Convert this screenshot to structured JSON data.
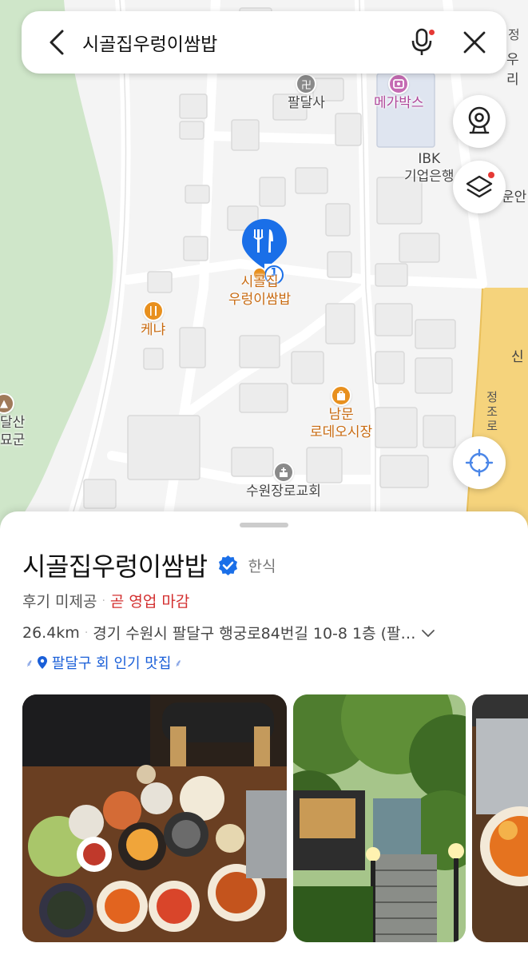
{
  "search": {
    "query": "시골집우렁이쌈밥"
  },
  "map": {
    "labels": {
      "paldalsa": "팔달사",
      "megabox": "메가박스",
      "ibk_line1": "IBK",
      "ibk_line2": "기업은행",
      "selected_line1": "시골집",
      "selected_line2": "우렁이쌈밥",
      "marker_badge": "1",
      "kenya": "케냐",
      "nammun_line1": "남문",
      "nammun_line2": "로데오시장",
      "church": "수원장로교회",
      "tomb_line1": "달산",
      "tomb_line2": "묘군",
      "road": "정조로",
      "edge_top": "정",
      "edge_top2": "우리",
      "edge_mid": "운안",
      "edge_shin": "신"
    },
    "colors": {
      "marker": "#1a6fe8",
      "food": "#e8901e",
      "road_yellow": "#f5d37c",
      "park": "#cfe6c9"
    }
  },
  "place": {
    "name": "시골집우렁이쌈밥",
    "category": "한식",
    "review_status": "후기 미제공",
    "hours_status": "곧 영업 마감",
    "distance": "26.4km",
    "address": "경기 수원시 팔달구 행궁로84번길 10-8 1층 (팔…",
    "badge": "팔달구 회 인기 맛집"
  },
  "photos": [
    {
      "name": "food-table-photo"
    },
    {
      "name": "entrance-photo"
    },
    {
      "name": "dish-photo"
    }
  ]
}
